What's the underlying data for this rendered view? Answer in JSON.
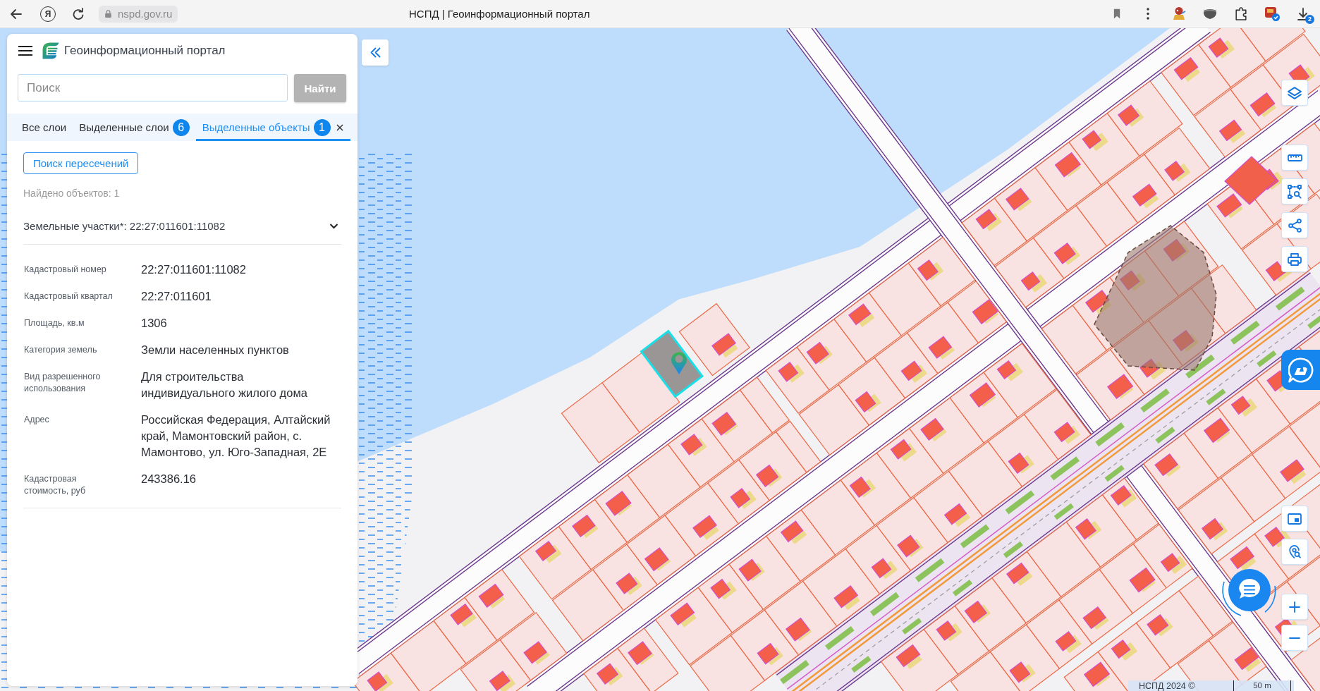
{
  "browser": {
    "home_letter": "Я",
    "url": "nspd.gov.ru",
    "title": "НСПД | Геоинформационный портал",
    "downloads_badge": "2"
  },
  "panel": {
    "app_title": "Геоинформационный портал",
    "search": {
      "placeholder": "Поиск",
      "button": "Найти",
      "button_disabled": true
    },
    "tabs": [
      {
        "label": "Все слои",
        "selected": false,
        "closable": false
      },
      {
        "label": "Выделенные слои",
        "badge": "6",
        "selected": false,
        "closable": false
      },
      {
        "label": "Выделенные объекты",
        "badge": "1",
        "selected": true,
        "closable": true
      }
    ],
    "intersect_button": "Поиск пересечений",
    "found_text": "Найдено объектов: 1",
    "section": {
      "title": "Земельные участки*: 22:27:011601:11082",
      "expanded": true,
      "properties": [
        {
          "label": "Кадастровый номер",
          "value": "22:27:011601:11082"
        },
        {
          "label": "Кадастровый квартал",
          "value": "22:27:011601"
        },
        {
          "label": "Площадь, кв.м",
          "value": "1306"
        },
        {
          "label": "Категория земель",
          "value": "Земли населенных пунктов"
        },
        {
          "label": "Вид разрешенного использования",
          "value": "Для строительства индивидуального жилого дома"
        },
        {
          "label": "Адрес",
          "value": "Российская Федерация, Алтайский край, Мамонтовский район, с. Мамонтово, ул. Юго-Западная, 2Е"
        },
        {
          "label": "Кадастровая стоимость, руб",
          "value": "243386.16"
        }
      ]
    }
  },
  "map": {
    "attribution": "НСПД 2024 ©",
    "scale_label": "50 m"
  }
}
